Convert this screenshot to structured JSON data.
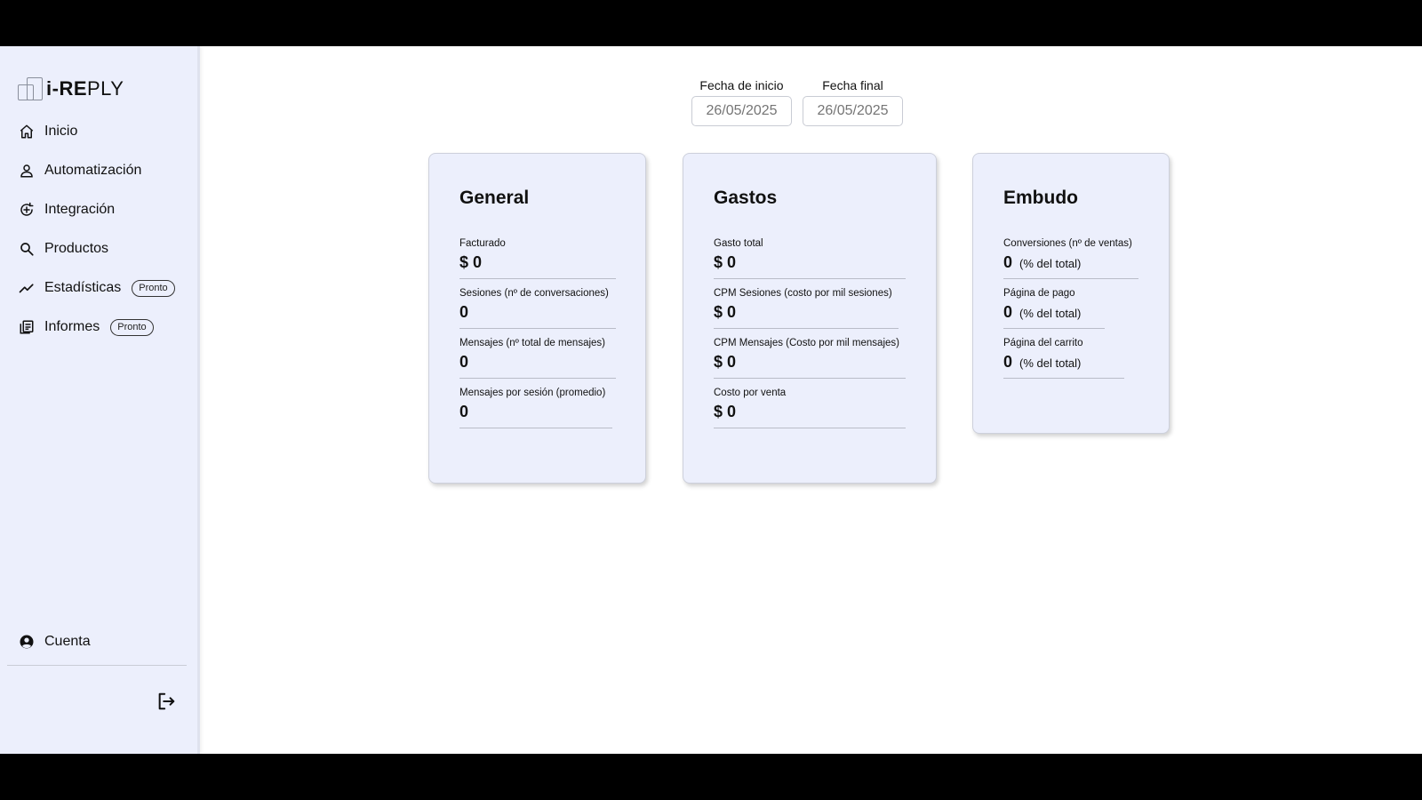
{
  "brand": {
    "prefix": "i-RE",
    "suffix": "PLY"
  },
  "sidebar": {
    "items": [
      {
        "label": "Inicio",
        "icon": "home-icon",
        "badge": ""
      },
      {
        "label": "Automatización",
        "icon": "user-icon",
        "badge": ""
      },
      {
        "label": "Integración",
        "icon": "integration-icon",
        "badge": ""
      },
      {
        "label": "Productos",
        "icon": "search-icon",
        "badge": ""
      },
      {
        "label": "Estadísticas",
        "icon": "trend-icon",
        "badge": "Pronto"
      },
      {
        "label": "Informes",
        "icon": "reports-icon",
        "badge": "Pronto"
      }
    ],
    "account_label": "Cuenta",
    "account_icon": "account-circle-icon",
    "logout_icon": "logout-icon"
  },
  "dates": {
    "start_label": "Fecha de inicio",
    "start_value": "26/05/2025",
    "end_label": "Fecha final",
    "end_value": "26/05/2025"
  },
  "cards": {
    "general": {
      "title": "General",
      "metrics": [
        {
          "label": "Facturado",
          "value": "$ 0"
        },
        {
          "label": "Sesiones (nº de conversaciones)",
          "value": "0"
        },
        {
          "label": "Mensajes (nº total de mensajes)",
          "value": "0"
        },
        {
          "label": "Mensajes por sesión (promedio)",
          "value": "0"
        }
      ]
    },
    "gastos": {
      "title": "Gastos",
      "metrics": [
        {
          "label": "Gasto total",
          "value": "$ 0"
        },
        {
          "label": "CPM Sesiones (costo por mil sesiones)",
          "value": "$ 0"
        },
        {
          "label": "CPM Mensajes (Costo por mil mensajes)",
          "value": "$ 0"
        },
        {
          "label": "Costo por venta",
          "value": "$ 0"
        }
      ]
    },
    "embudo": {
      "title": "Embudo",
      "metrics": [
        {
          "label": "Conversiones (nº de ventas)",
          "value": "0",
          "pct": "(% del total)"
        },
        {
          "label": "Página de pago",
          "value": "0",
          "pct": "(% del total)"
        },
        {
          "label": "Página del carrito",
          "value": "0",
          "pct": "(% del total)"
        }
      ]
    }
  }
}
